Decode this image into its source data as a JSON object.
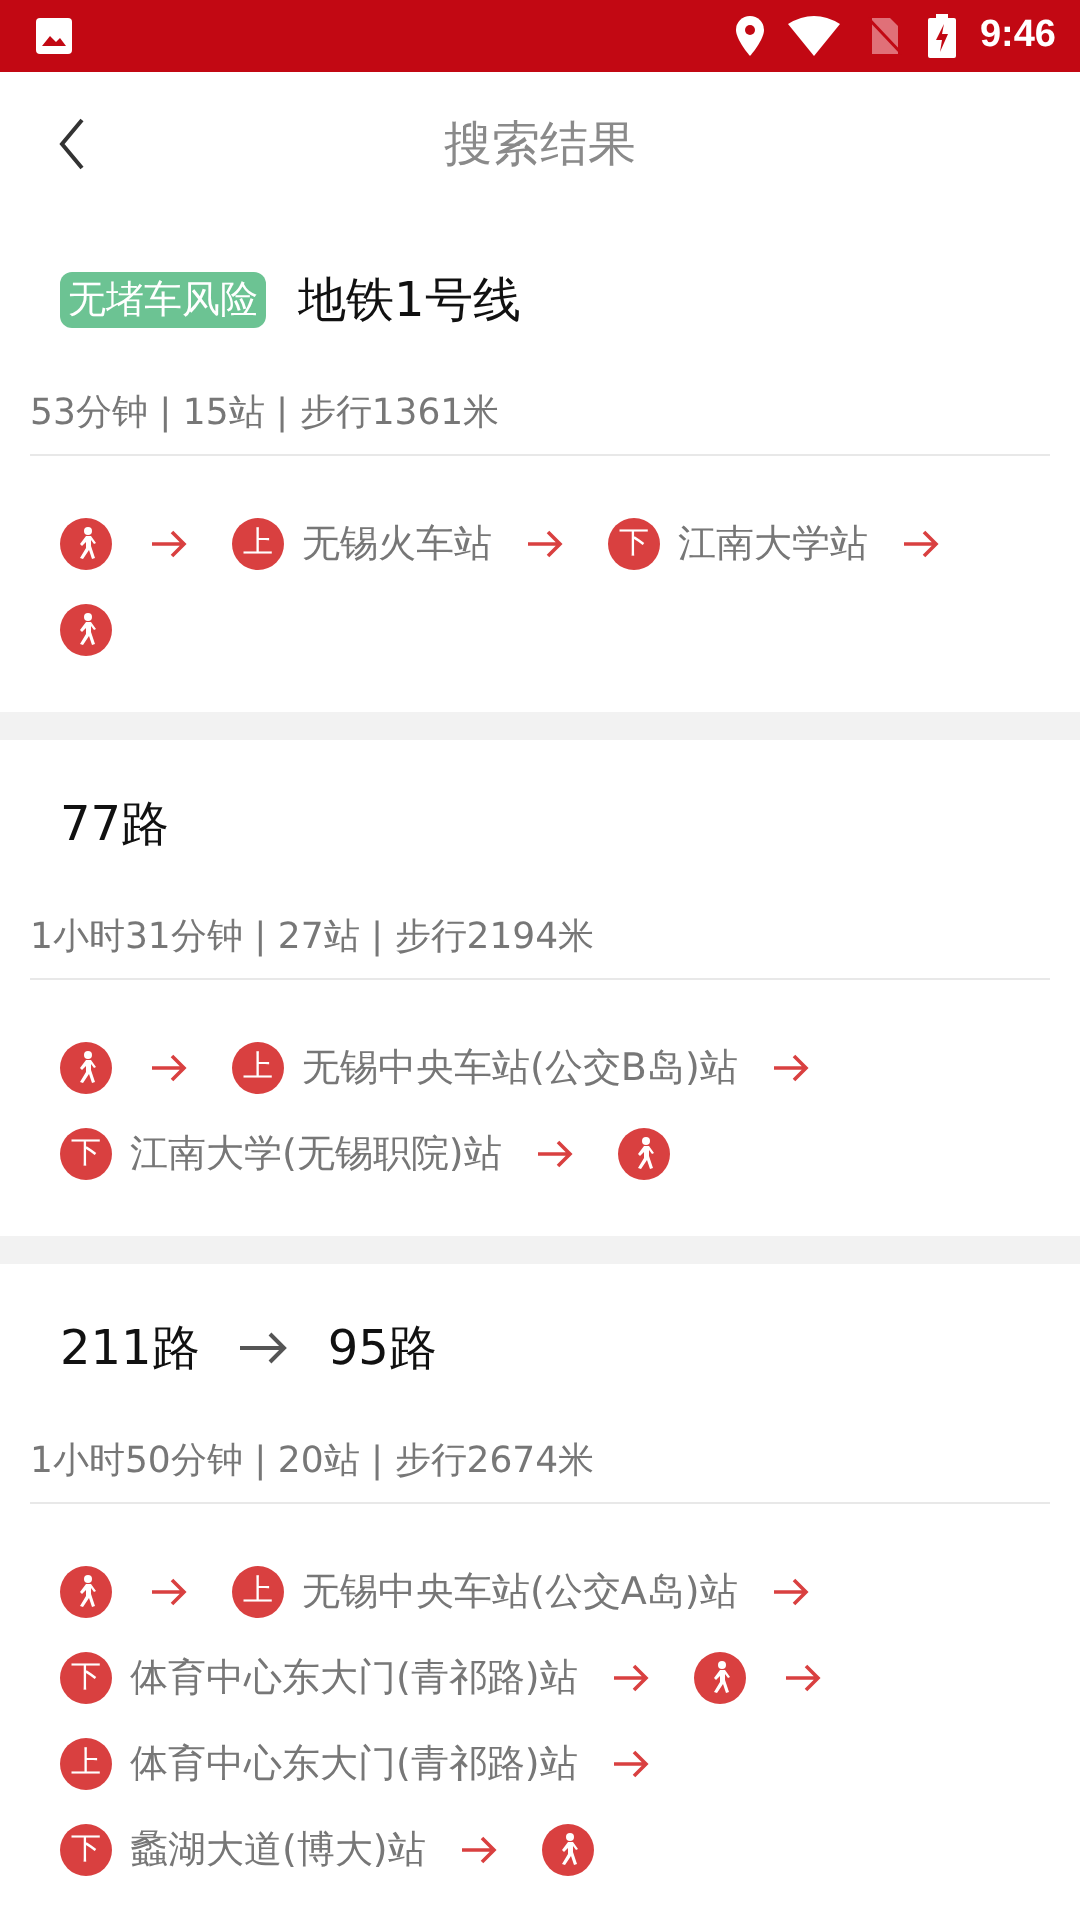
{
  "status_bar": {
    "time": "9:46"
  },
  "header": {
    "title": "搜索结果"
  },
  "routes": [
    {
      "tag": "无堵车风险",
      "lines": [
        "地铁1号线"
      ],
      "summary": "53分钟 | 15站 | 步行1361米",
      "step_lines": [
        [
          {
            "kind": "walk"
          },
          {
            "kind": "arrow"
          },
          {
            "kind": "board",
            "badge": "上",
            "station": "无锡火车站"
          },
          {
            "kind": "arrow"
          },
          {
            "kind": "alight",
            "badge": "下",
            "station": "江南大学站"
          },
          {
            "kind": "arrow"
          }
        ],
        [
          {
            "kind": "walk"
          }
        ]
      ]
    },
    {
      "lines": [
        "77路"
      ],
      "summary": "1小时31分钟 | 27站 | 步行2194米",
      "step_lines": [
        [
          {
            "kind": "walk"
          },
          {
            "kind": "arrow"
          },
          {
            "kind": "board",
            "badge": "上",
            "station": "无锡中央车站(公交B岛)站"
          },
          {
            "kind": "arrow"
          }
        ],
        [
          {
            "kind": "alight",
            "badge": "下",
            "station": "江南大学(无锡职院)站"
          },
          {
            "kind": "arrow"
          },
          {
            "kind": "walk"
          }
        ]
      ]
    },
    {
      "lines": [
        "211路",
        "95路"
      ],
      "summary": "1小时50分钟 | 20站 | 步行2674米",
      "step_lines": [
        [
          {
            "kind": "walk"
          },
          {
            "kind": "arrow"
          },
          {
            "kind": "board",
            "badge": "上",
            "station": "无锡中央车站(公交A岛)站"
          },
          {
            "kind": "arrow"
          }
        ],
        [
          {
            "kind": "alight",
            "badge": "下",
            "station": "体育中心东大门(青祁路)站"
          },
          {
            "kind": "arrow"
          },
          {
            "kind": "walk"
          },
          {
            "kind": "arrow"
          }
        ],
        [
          {
            "kind": "board",
            "badge": "上",
            "station": "体育中心东大门(青祁路)站"
          },
          {
            "kind": "arrow"
          }
        ],
        [
          {
            "kind": "alight",
            "badge": "下",
            "station": "蠡湖大道(博大)站"
          },
          {
            "kind": "arrow"
          },
          {
            "kind": "walk"
          }
        ]
      ]
    }
  ]
}
